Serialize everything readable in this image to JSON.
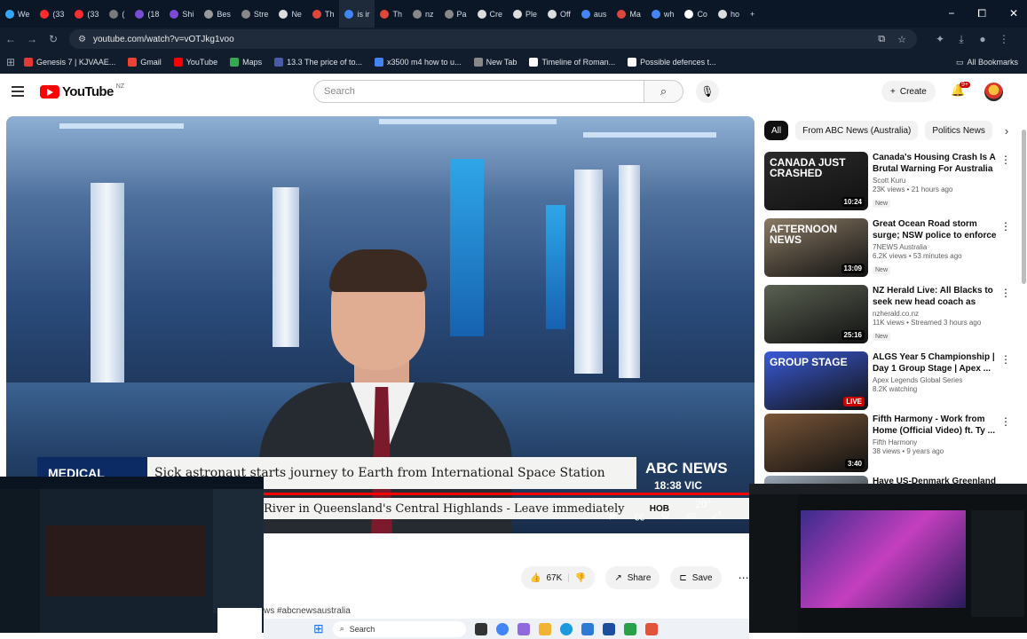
{
  "browser": {
    "tabs": [
      {
        "label": "We",
        "color": "#35a7ff"
      },
      {
        "label": "(33",
        "color": "#ff2d2d"
      },
      {
        "label": "(33",
        "color": "#ff2d2d"
      },
      {
        "label": "(",
        "color": "#7a7a7a"
      },
      {
        "label": "(18",
        "color": "#7b4bd6"
      },
      {
        "label": "Shi",
        "color": "#7b4bd6"
      },
      {
        "label": "Bes",
        "color": "#999999"
      },
      {
        "label": "Stre",
        "color": "#888888"
      },
      {
        "label": "Ne",
        "color": "#dddddd"
      },
      {
        "label": "Th",
        "color": "#e0453a"
      },
      {
        "label": "is ir",
        "color": "#4285f4"
      },
      {
        "label": "Th",
        "color": "#e0453a"
      },
      {
        "label": "nz",
        "color": "#888888"
      },
      {
        "label": "Pa",
        "color": "#888888"
      },
      {
        "label": "Cre",
        "color": "#dddddd"
      },
      {
        "label": "Ple",
        "color": "#dddddd"
      },
      {
        "label": "Off",
        "color": "#dddddd"
      },
      {
        "label": "aus",
        "color": "#4285f4"
      },
      {
        "label": "Ma",
        "color": "#e0453a"
      },
      {
        "label": "wh",
        "color": "#4285f4"
      },
      {
        "label": "Co",
        "color": "#ffffff"
      },
      {
        "label": "ho",
        "color": "#dddddd"
      }
    ],
    "new_tab": "+",
    "window_controls": [
      "−",
      "⧠",
      "✕"
    ],
    "url": "youtube.com/watch?v=vOTJkg1voo",
    "bookmarks": [
      {
        "label": "Genesis 7 | KJVAAE...",
        "color": "#e53935"
      },
      {
        "label": "Gmail",
        "color": "#ea4335"
      },
      {
        "label": "YouTube",
        "color": "#ff0000"
      },
      {
        "label": "Maps",
        "color": "#34a853"
      },
      {
        "label": "13.3 The price of to...",
        "color": "#4a5aa8"
      },
      {
        "label": "x3500 m4 how to u...",
        "color": "#4285f4"
      },
      {
        "label": "New Tab",
        "color": "#888888"
      },
      {
        "label": "Timeline of Roman...",
        "color": "#ffffff"
      },
      {
        "label": "Possible defences t...",
        "color": "#ffffff"
      }
    ],
    "all_bookmarks": "All Bookmarks"
  },
  "youtube": {
    "logo_text": "YouTube",
    "country": "NZ",
    "search_placeholder": "Search",
    "create_label": "Create",
    "notif_count": "9+"
  },
  "video": {
    "lower_third_tag": "MEDICAL",
    "headline": "Sick astronaut starts journey to Earth from International Space Station",
    "network": "ABC NEWS",
    "clock": "18:38 VIC",
    "ticker": "River in Queensland's Central Highlands - Leave immediately",
    "ticker_location": "HOB",
    "temperature": "20°",
    "progress": 0.999
  },
  "actions": {
    "like_count": "67K",
    "share_label": "Share",
    "save_label": "Save"
  },
  "description_snippet": "ws #abcnewsaustralia",
  "chips": [
    "All",
    "From ABC News (Australia)",
    "Politics News"
  ],
  "recommendations": [
    {
      "title": "Canada's Housing Crash Is A Brutal Warning For Australia ...",
      "channel": "Scott Kuru",
      "meta": "23K views • 21 hours ago",
      "badge": "New",
      "duration": "10:24",
      "thumb_text": "CANADA JUST CRASHED",
      "thumb_color": "#2b2b2b"
    },
    {
      "title": "Great Ocean Road storm surge; NSW police to enforce protest ...",
      "channel": "7NEWS Australia",
      "meta": "6.2K views • 53 minutes ago",
      "badge": "New",
      "duration": "13:09",
      "thumb_text": "AFTERNOON NEWS",
      "thumb_color": "#8a7a64"
    },
    {
      "title": "NZ Herald Live: All Blacks to seek new head coach as Scott...",
      "channel": "nzherald.co.nz",
      "meta": "11K views • Streamed 3 hours ago",
      "badge": "New",
      "duration": "25:16",
      "thumb_text": "",
      "thumb_color": "#5a6152"
    },
    {
      "title": "ALGS Year 5 Championship | Day 1 Group Stage | Apex ...",
      "channel": "Apex Legends Global Series",
      "meta": "8.2K watching",
      "badge": "",
      "duration": "LIVE",
      "thumb_text": "GROUP STAGE",
      "thumb_color": "#3b5bd8"
    },
    {
      "title": "Fifth Harmony - Work from Home (Official Video) ft. Ty ...",
      "channel": "Fifth Harmony",
      "meta": "38 views • 9 years ago",
      "badge": "",
      "duration": "3:40",
      "thumb_text": "",
      "thumb_color": "#7a5638"
    },
    {
      "title": "Have US-Denmark Greenland",
      "channel": "",
      "meta": "",
      "badge": "",
      "duration": "",
      "thumb_text": "",
      "thumb_color": "#9aa7b5"
    }
  ],
  "taskbar": {
    "search_label": "Search"
  }
}
